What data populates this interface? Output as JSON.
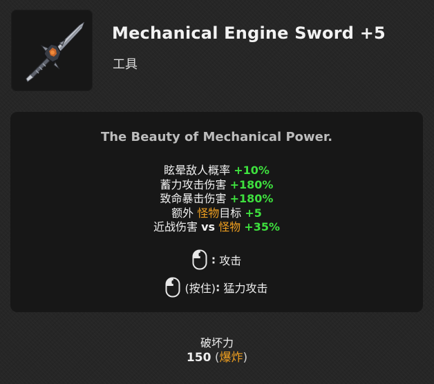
{
  "item": {
    "name": "Mechanical Engine Sword +5",
    "type": "工具",
    "icon": "mechanical-sword-icon"
  },
  "tooltip": {
    "flavor": "The Beauty of Mechanical Power.",
    "stats": [
      {
        "label": "眩晕敌人概率",
        "value": "+10%"
      },
      {
        "label": "蓄力攻击伤害",
        "value": "+180%"
      },
      {
        "label": "致命暴击伤害",
        "value": "+180%"
      },
      {
        "label_pre": "额外",
        "target": "怪物",
        "label_post": "目标",
        "value": "+5"
      },
      {
        "label_pre": "近战伤害",
        "connector": "vs",
        "target": "怪物",
        "value": "+35%"
      }
    ],
    "controls": [
      {
        "icon": "mouse-left-click-icon",
        "prefix": "",
        "separator": ":",
        "action": "攻击"
      },
      {
        "icon": "mouse-left-hold-icon",
        "prefix": "(按住)",
        "separator": ":",
        "action": "猛力攻击"
      }
    ]
  },
  "power": {
    "label": "破坏力",
    "value": "150",
    "paren_open": "(",
    "type": "爆炸",
    "paren_close": ")"
  },
  "colors": {
    "stat_value": "#3ee03e",
    "target_highlight": "#f0a020",
    "panel_bg": "#171717",
    "page_bg": "#262626"
  }
}
